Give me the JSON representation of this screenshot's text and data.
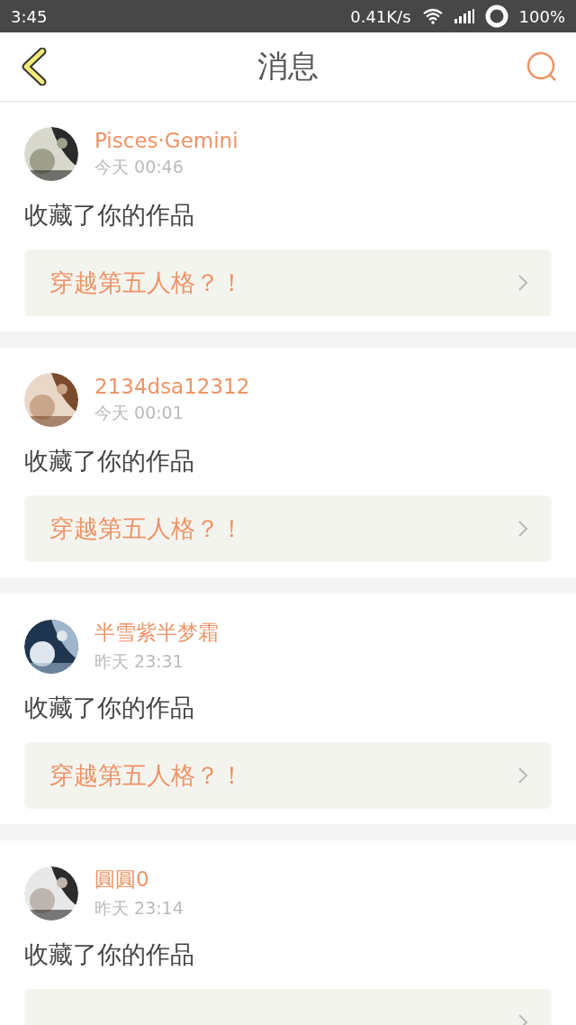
{
  "status_bar": {
    "time": "3:45",
    "speed": "0.41K/s",
    "battery": "100%"
  },
  "header": {
    "title": "消息"
  },
  "messages": [
    {
      "user": "Pisces·Gemini",
      "time": "今天 00:46",
      "action": "收藏了你的作品",
      "link": "穿越第五人格？！"
    },
    {
      "user": "2134dsa12312",
      "time": "今天 00:01",
      "action": "收藏了你的作品",
      "link": "穿越第五人格？！"
    },
    {
      "user": "半雪紫半梦霜",
      "time": "昨天 23:31",
      "action": "收藏了你的作品",
      "link": "穿越第五人格？！"
    },
    {
      "user": "圓圓0",
      "time": "昨天 23:14",
      "action": "收藏了你的作品"
    }
  ]
}
